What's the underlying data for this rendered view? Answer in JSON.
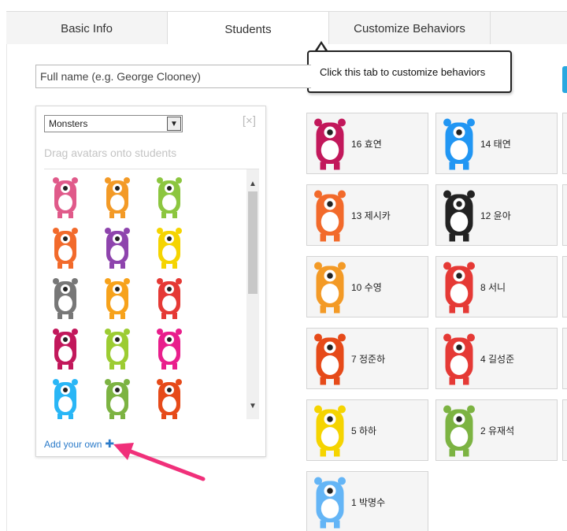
{
  "tabs": [
    {
      "label": "Basic Info"
    },
    {
      "label": "Students"
    },
    {
      "label": "Customize Behaviors"
    }
  ],
  "tooltip": {
    "text": "Click this tab to customize behaviors"
  },
  "name_input": {
    "placeholder": "Full name (e.g. George Clooney)"
  },
  "avatar_panel": {
    "category": "Monsters",
    "close_label": "[×]",
    "drag_hint": "Drag avatars onto students",
    "add_own": "Add your own",
    "avatars": [
      {
        "icon": "pink-cyclops-monster-icon",
        "color": "#e05a8a"
      },
      {
        "icon": "orange-monster-icon",
        "color": "#f39a26"
      },
      {
        "icon": "green-monster-icon",
        "color": "#8cc63f"
      },
      {
        "icon": "red-orange-monster-icon",
        "color": "#f26a2b"
      },
      {
        "icon": "purple-monster-icon",
        "color": "#8e44ad"
      },
      {
        "icon": "black-yellow-monster-icon",
        "color": "#f5d400"
      },
      {
        "icon": "grey-horned-monster-icon",
        "color": "#777777"
      },
      {
        "icon": "orange-cyclops-monster-icon",
        "color": "#f7a21b"
      },
      {
        "icon": "red-monster-icon",
        "color": "#e53935"
      },
      {
        "icon": "magenta-monster-icon",
        "color": "#c2185b"
      },
      {
        "icon": "lime-monster-icon",
        "color": "#9ccc32"
      },
      {
        "icon": "pink-one-eye-monster-icon",
        "color": "#e91e8c"
      },
      {
        "icon": "cyan-monster-icon",
        "color": "#29b6f6"
      },
      {
        "icon": "green-tall-monster-icon",
        "color": "#7cb342"
      },
      {
        "icon": "red-furry-monster-icon",
        "color": "#e64a19"
      }
    ]
  },
  "students": [
    {
      "name": "16 효연",
      "icon": "magenta-monster-icon",
      "color": "#c2185b"
    },
    {
      "name": "14 태연",
      "icon": "blue-monster-icon",
      "color": "#2196f3"
    },
    {
      "name": "13 제시카",
      "icon": "red-orange-monster-icon",
      "color": "#f26a2b"
    },
    {
      "name": "12 윤아",
      "icon": "black-white-monster-icon",
      "color": "#222222"
    },
    {
      "name": "10 수영",
      "icon": "orange-monster-icon",
      "color": "#f39a26"
    },
    {
      "name": "8 서니",
      "icon": "red-monster-icon",
      "color": "#e53935"
    },
    {
      "name": "7 정준하",
      "icon": "red-furry-monster-icon",
      "color": "#e64a19"
    },
    {
      "name": "4 길성준",
      "icon": "red-monster-icon",
      "color": "#e53935"
    },
    {
      "name": "5 하하",
      "icon": "black-yellow-monster-icon",
      "color": "#f5d400"
    },
    {
      "name": "2 유재석",
      "icon": "green-cyclops-monster-icon",
      "color": "#7cb342"
    },
    {
      "name": "1 박명수",
      "icon": "blue-four-eyed-monster-icon",
      "color": "#64b5f6"
    }
  ],
  "colors": {
    "link": "#2a7ac9",
    "accent_button": "#29a8e0",
    "annotation_arrow": "#f0307a"
  }
}
